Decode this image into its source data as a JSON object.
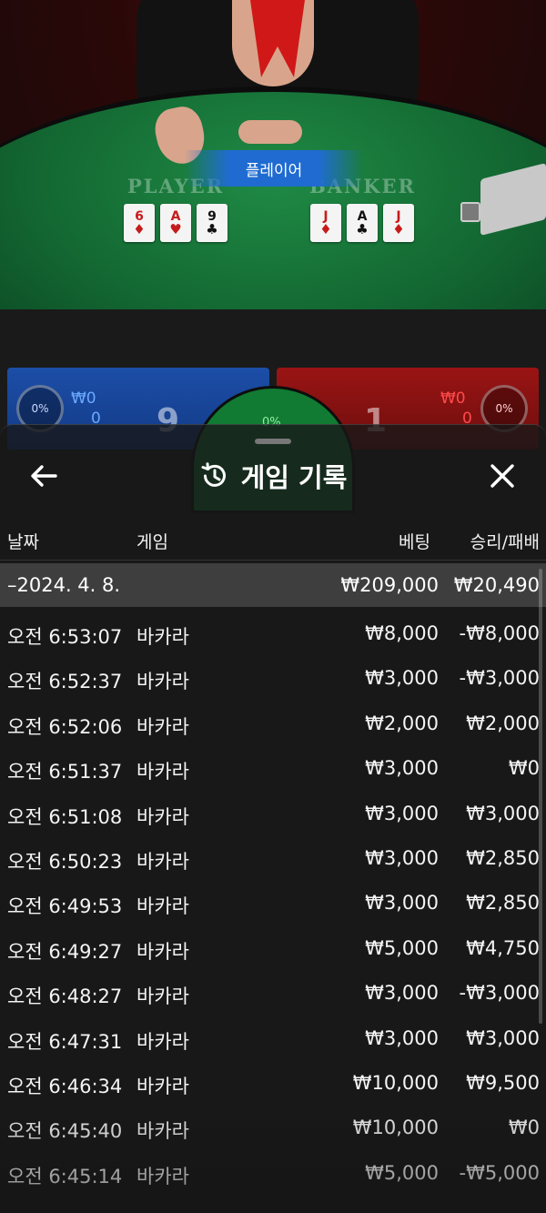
{
  "game_view": {
    "banner_label": "플레이어",
    "player_label": "PLAYER",
    "banker_label": "BANKER",
    "player_cards": [
      {
        "rank": "6",
        "suit": "♦",
        "color": "red"
      },
      {
        "rank": "A",
        "suit": "♥",
        "color": "red"
      },
      {
        "rank": "9",
        "suit": "♣",
        "color": "black"
      }
    ],
    "banker_cards": [
      {
        "rank": "J",
        "suit": "♦",
        "color": "red"
      },
      {
        "rank": "A",
        "suit": "♣",
        "color": "black"
      },
      {
        "rank": "J",
        "suit": "♦",
        "color": "red"
      }
    ],
    "player_pct": "0%",
    "banker_pct": "0%",
    "tie_pct": "0%",
    "player_bet": "₩0",
    "player_count": "0",
    "banker_bet": "₩0",
    "banker_count": "0",
    "player_score": "9",
    "banker_score": "1"
  },
  "history": {
    "title": "게임 기록",
    "columns": {
      "date": "날짜",
      "game": "게임",
      "bet": "베팅",
      "result": "승리/패배"
    },
    "summary": {
      "date": "–2024. 4. 8.",
      "bet": "₩209,000",
      "result": "₩20,490"
    },
    "rows": [
      {
        "time": "오전 6:53:07",
        "game": "바카라",
        "bet": "₩8,000",
        "result": "-₩8,000"
      },
      {
        "time": "오전 6:52:37",
        "game": "바카라",
        "bet": "₩3,000",
        "result": "-₩3,000"
      },
      {
        "time": "오전 6:52:06",
        "game": "바카라",
        "bet": "₩2,000",
        "result": "₩2,000"
      },
      {
        "time": "오전 6:51:37",
        "game": "바카라",
        "bet": "₩3,000",
        "result": "₩0"
      },
      {
        "time": "오전 6:51:08",
        "game": "바카라",
        "bet": "₩3,000",
        "result": "₩3,000"
      },
      {
        "time": "오전 6:50:23",
        "game": "바카라",
        "bet": "₩3,000",
        "result": "₩2,850"
      },
      {
        "time": "오전 6:49:53",
        "game": "바카라",
        "bet": "₩3,000",
        "result": "₩2,850"
      },
      {
        "time": "오전 6:49:27",
        "game": "바카라",
        "bet": "₩5,000",
        "result": "₩4,750"
      },
      {
        "time": "오전 6:48:27",
        "game": "바카라",
        "bet": "₩3,000",
        "result": "-₩3,000"
      },
      {
        "time": "오전 6:47:31",
        "game": "바카라",
        "bet": "₩3,000",
        "result": "₩3,000"
      },
      {
        "time": "오전 6:46:34",
        "game": "바카라",
        "bet": "₩10,000",
        "result": "₩9,500"
      },
      {
        "time": "오전 6:45:40",
        "game": "바카라",
        "bet": "₩10,000",
        "result": "₩0"
      },
      {
        "time": "오전 6:45:14",
        "game": "바카라",
        "bet": "₩5,000",
        "result": "-₩5,000"
      }
    ]
  },
  "icons": {
    "back": "arrow-left-icon",
    "history": "history-clock-icon",
    "close": "close-icon"
  },
  "colors": {
    "player_blue": "#1f6bd1",
    "banker_red": "#9a1414",
    "felt_green": "#146a33",
    "summary_bg": "#5a5a5a"
  }
}
